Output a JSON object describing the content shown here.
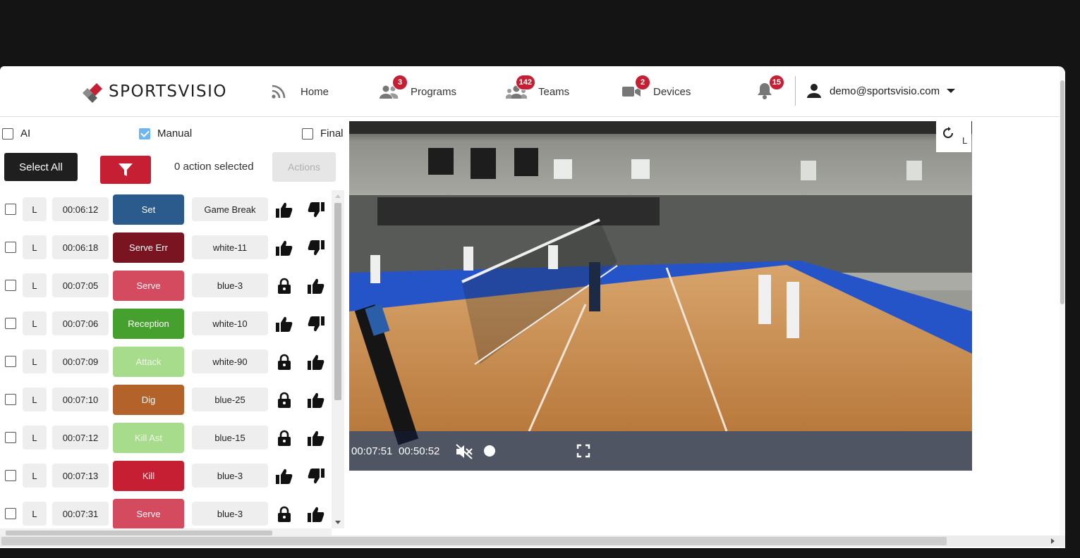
{
  "brand": {
    "name": "SPORTSVISIO",
    "accent": "#c61f33"
  },
  "nav": {
    "home": {
      "label": "Home"
    },
    "programs": {
      "label": "Programs",
      "badge": "3"
    },
    "teams": {
      "label": "Teams",
      "badge": "142"
    },
    "devices": {
      "label": "Devices",
      "badge": "2"
    },
    "notifications": {
      "badge": "15"
    },
    "user": {
      "email": "demo@sportsvisio.com"
    }
  },
  "filters": {
    "ai": {
      "label": "AI",
      "checked": false
    },
    "manual": {
      "label": "Manual",
      "checked": true
    },
    "final": {
      "label": "Final",
      "checked": false
    }
  },
  "toolbar": {
    "select_all": "Select All",
    "selection_status": "0 action selected",
    "actions": "Actions"
  },
  "rows": [
    {
      "side": "L",
      "time": "00:06:12",
      "action": "Set",
      "color": "#2a5b8c",
      "text_color": "#ffffff",
      "player": "Game Break",
      "icons": [
        "thumb-up-icon",
        "thumb-down-icon"
      ]
    },
    {
      "side": "L",
      "time": "00:06:18",
      "action": "Serve Err",
      "color": "#7a1420",
      "text_color": "#ffffff",
      "player": "white-11",
      "icons": [
        "thumb-up-icon",
        "thumb-down-icon"
      ]
    },
    {
      "side": "L",
      "time": "00:07:05",
      "action": "Serve",
      "color": "#d44b5f",
      "text_color": "#ffffff",
      "player": "blue-3",
      "icons": [
        "lock-icon",
        "thumb-up-icon"
      ]
    },
    {
      "side": "L",
      "time": "00:07:06",
      "action": "Reception",
      "color": "#46a02e",
      "text_color": "#ffffff",
      "player": "white-10",
      "icons": [
        "thumb-up-icon",
        "thumb-down-icon"
      ]
    },
    {
      "side": "L",
      "time": "00:07:09",
      "action": "Attack",
      "color": "#a7dc8c",
      "text_color": "#eef7e8",
      "player": "white-90",
      "icons": [
        "lock-icon",
        "thumb-up-icon"
      ]
    },
    {
      "side": "L",
      "time": "00:07:10",
      "action": "Dig",
      "color": "#b3622a",
      "text_color": "#ffffff",
      "player": "blue-25",
      "icons": [
        "lock-icon",
        "thumb-up-icon"
      ]
    },
    {
      "side": "L",
      "time": "00:07:12",
      "action": "Kill Ast",
      "color": "#a7dc8c",
      "text_color": "#eef7e8",
      "player": "blue-15",
      "icons": [
        "lock-icon",
        "thumb-up-icon"
      ]
    },
    {
      "side": "L",
      "time": "00:07:13",
      "action": "Kill",
      "color": "#c61f33",
      "text_color": "#ffffff",
      "player": "blue-3",
      "icons": [
        "thumb-up-icon",
        "thumb-down-icon"
      ]
    },
    {
      "side": "L",
      "time": "00:07:31",
      "action": "Serve",
      "color": "#d44b5f",
      "text_color": "#ffffff",
      "player": "blue-3",
      "icons": [
        "lock-icon",
        "thumb-up-icon"
      ]
    }
  ],
  "video": {
    "current_time": "00:07:51",
    "duration": "00:50:52",
    "muted": true,
    "rotate_label": "L",
    "progress": 0.154
  }
}
